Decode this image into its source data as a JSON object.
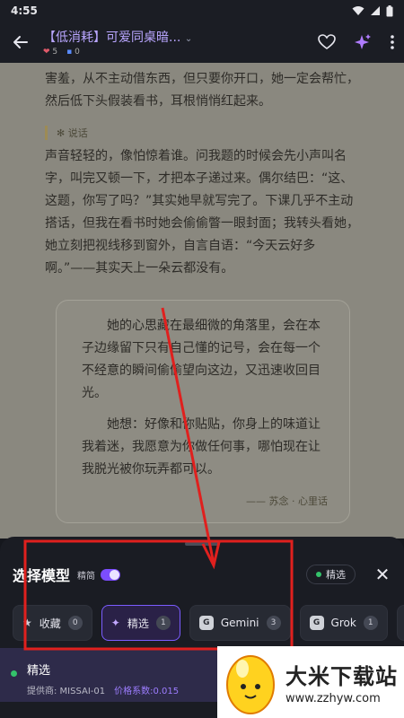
{
  "status": {
    "time": "4:55"
  },
  "appbar": {
    "title": "【低消耗】可爱同桌暗...",
    "likes": "5",
    "comments": "0"
  },
  "article": {
    "para1": "害羞，从不主动借东西，但只要你开口，她一定会帮忙，然后低下头假装看书，耳根悄悄红起来。",
    "quote_label": "说话",
    "para2": "声音轻轻的，像怕惊着谁。问我题的时候会先小声叫名字，叫完又顿一下，才把本子递过来。偶尔结巴：“这、这题，你写了吗？”其实她早就写完了。下课几乎不主动搭话，但我在看书时她会偷偷瞥一眼封面；我转头看她，她立刻把视线移到窗外，自言自语：“今天云好多啊。”——其实天上一朵云都没有。",
    "card_p1": "她的心思藏在最细微的角落里，会在本子边缘留下只有自己懂的记号，会在每一个不经意的瞬间偷偷望向这边，又迅速收回目光。",
    "card_p2": "她想：好像和你贴贴，你身上的味道让我着迷，我愿意为你做任何事，哪怕现在让我脱光被你玩弄都可以。",
    "card_sig": "—— 苏念 · 心里话"
  },
  "sheet": {
    "title": "选择模型",
    "compact_label": "精简",
    "featured_badge": "精选",
    "tabs": [
      {
        "label": "收藏",
        "count": "0"
      },
      {
        "label": "精选",
        "count": "1"
      },
      {
        "label": "Gemini",
        "count": "3",
        "glyph": "G"
      },
      {
        "label": "Grok",
        "count": "1",
        "glyph": "G"
      }
    ],
    "model": {
      "name": "精选",
      "provider": "提供商: MISSAI-01",
      "price": "价格系数:0.015"
    }
  },
  "watermark": {
    "title": "大米下载站",
    "url": "www.zzhyw.com"
  },
  "colors": {
    "accent": "#7c4dff",
    "annotation": "#e0201e",
    "online": "#34c36b"
  }
}
